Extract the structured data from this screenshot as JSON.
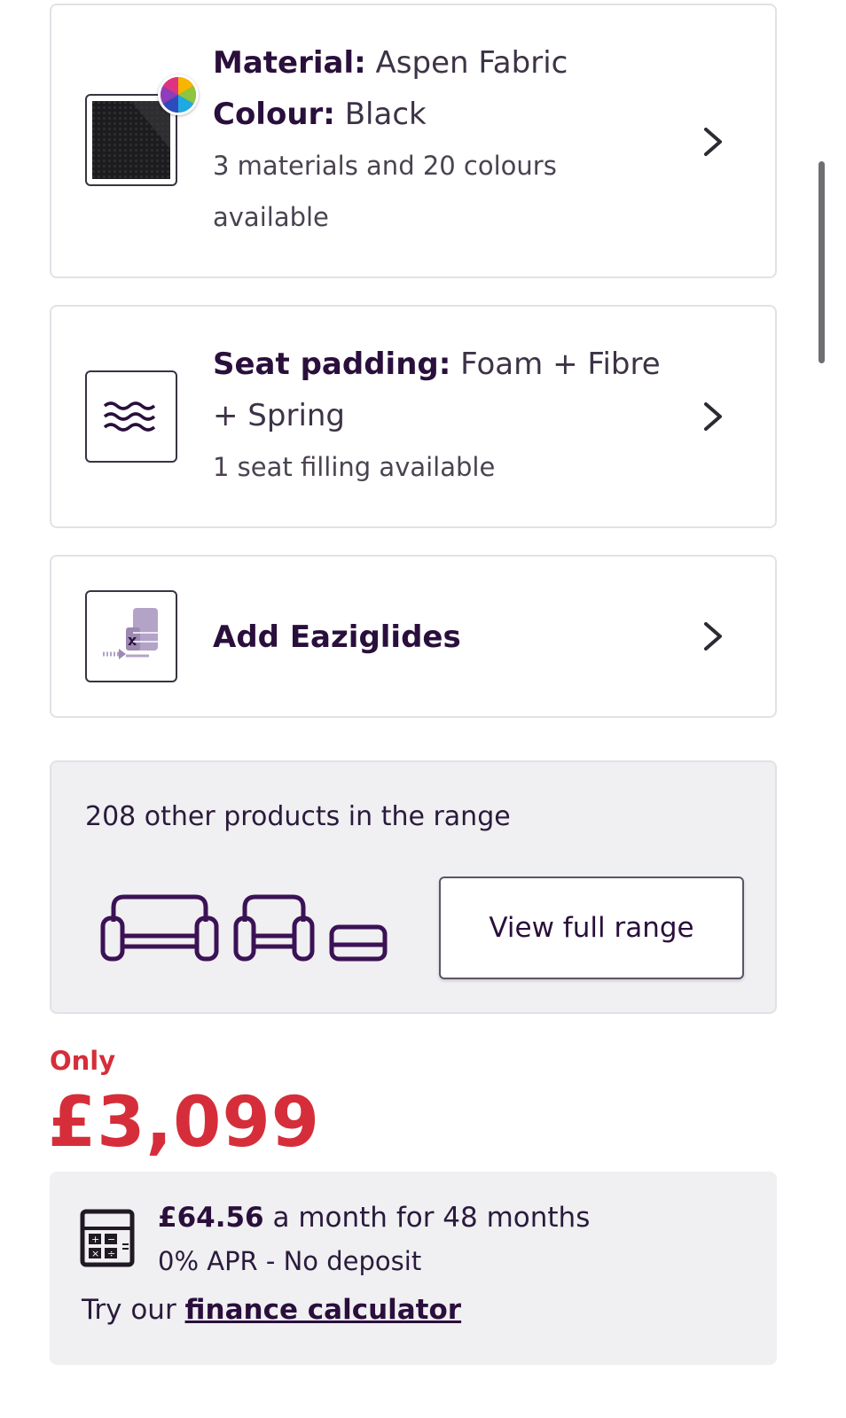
{
  "options": {
    "material": {
      "material_label": "Material:",
      "material_value": "Aspen Fabric",
      "colour_label": "Colour:",
      "colour_value": "Black",
      "availability_line1": "3 materials and 20 colours",
      "availability_line2": "available",
      "icon": "fabric-swatch-icon"
    },
    "seat_padding": {
      "label": "Seat padding:",
      "value_line1": "Foam + Fibre",
      "value_line2": "+ Spring",
      "availability": "1 seat filling available",
      "icon": "waves-icon"
    },
    "eaziglides": {
      "label": "Add Eaziglides",
      "icon": "eaziglides-icon"
    }
  },
  "range": {
    "title": "208 other products in the range",
    "button_label": "View full range",
    "icons": [
      "sofa-icon",
      "armchair-icon",
      "footstool-icon"
    ]
  },
  "pricing": {
    "only_label": "Only",
    "price": "£3,099",
    "accent_color": "#d52e3a"
  },
  "finance": {
    "monthly_amount": "£64.56",
    "monthly_text": " a month for 48 months",
    "apr_text": "0% APR - No deposit",
    "try_text": "Try our ",
    "link_text": "finance calculator",
    "icon": "calculator-icon"
  }
}
